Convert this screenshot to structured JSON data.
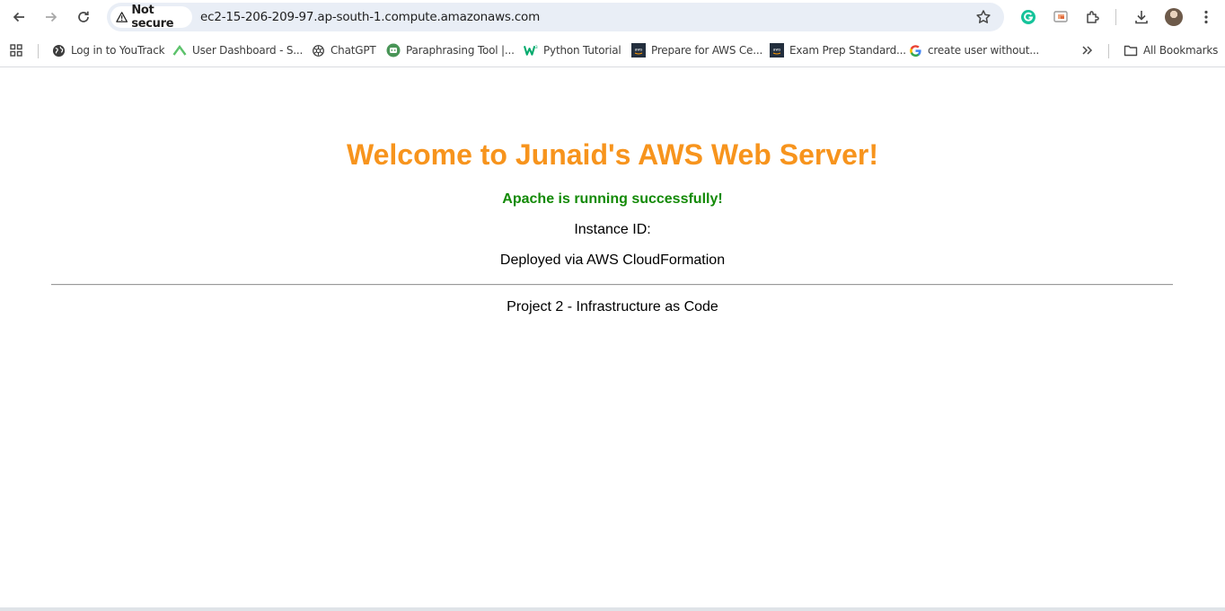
{
  "browser": {
    "security_label": "Not secure",
    "url": "ec2-15-206-209-97.ap-south-1.compute.amazonaws.com"
  },
  "bookmarks": {
    "items": [
      {
        "label": "Log in to YouTrack",
        "icon": "globe-icon"
      },
      {
        "label": "User Dashboard - S...",
        "icon": "chevron-logo-icon"
      },
      {
        "label": "ChatGPT",
        "icon": "chatgpt-icon"
      },
      {
        "label": "Paraphrasing Tool |...",
        "icon": "quillbot-icon"
      },
      {
        "label": "Python Tutorial",
        "icon": "w3schools-icon"
      },
      {
        "label": "Prepare for AWS Ce...",
        "icon": "aws-icon"
      },
      {
        "label": "Exam Prep Standard...",
        "icon": "aws-icon"
      },
      {
        "label": "create user without...",
        "icon": "google-icon"
      }
    ],
    "all_bookmarks_label": "All Bookmarks"
  },
  "page": {
    "headline": "Welcome to Junaid's AWS Web Server!",
    "status": "Apache is running successfully!",
    "instance_label": "Instance ID:",
    "deployed_text": "Deployed via AWS CloudFormation",
    "footer_text": "Project 2 - Infrastructure as Code"
  },
  "colors": {
    "headline": "#f7941d",
    "status": "#138a07"
  }
}
